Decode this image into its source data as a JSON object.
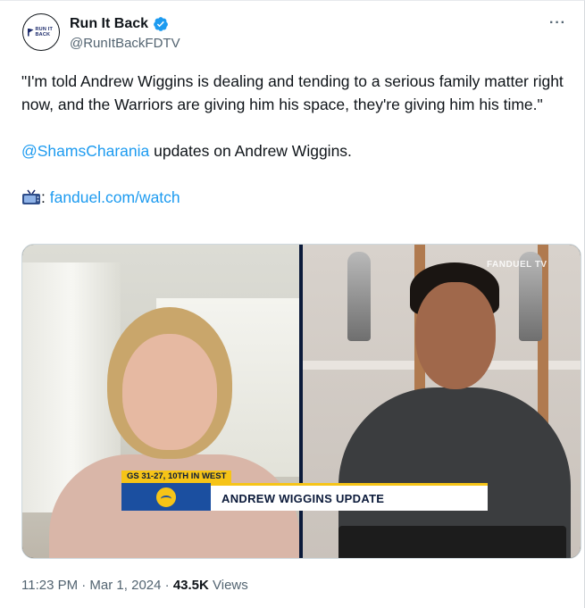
{
  "author": {
    "display_name": "Run It Back",
    "handle": "@RunItBackFDTV",
    "avatar_text": "RUN IT BACK"
  },
  "more_label": "···",
  "tweet": {
    "quote": "\"I'm told Andrew Wiggins is dealing and tending to a serious family matter right now, and the Warriors are giving him his space, they're giving him his time.\"",
    "mention": "@ShamsCharania",
    "mention_suffix": " updates on Andrew Wiggins.",
    "tv_sep": ": ",
    "link": "fanduel.com/watch"
  },
  "video": {
    "brand": "FANDUEL TV",
    "record": "GS 31-27, 10TH IN WEST",
    "headline": "ANDREW WIGGINS UPDATE"
  },
  "meta": {
    "time": "11:23 PM · Mar 1, 2024 · ",
    "views_count": "43.5K",
    "views_label": " Views"
  },
  "colors": {
    "link": "#1d9bf0",
    "verified": "#1d9bf0",
    "muted": "#536471"
  }
}
